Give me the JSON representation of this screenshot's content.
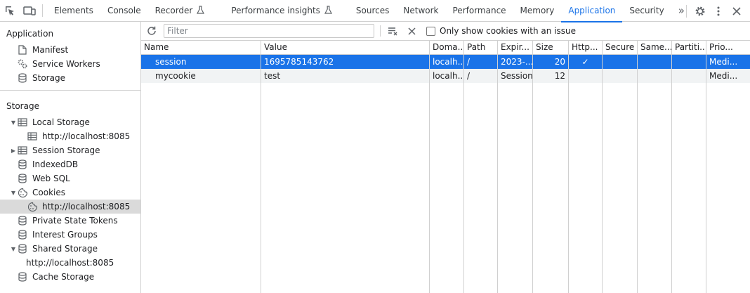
{
  "topbar": {
    "tabs": [
      {
        "label": "Elements"
      },
      {
        "label": "Console"
      },
      {
        "label": "Recorder"
      },
      {
        "label": "Performance insights"
      },
      {
        "label": "Sources"
      },
      {
        "label": "Network"
      },
      {
        "label": "Performance"
      },
      {
        "label": "Memory"
      },
      {
        "label": "Application",
        "active": true
      },
      {
        "label": "Security"
      }
    ],
    "more_label": "»"
  },
  "sidebar": {
    "application_title": "Application",
    "application_items": [
      {
        "label": "Manifest",
        "icon": "document-icon"
      },
      {
        "label": "Service Workers",
        "icon": "gears-icon"
      },
      {
        "label": "Storage",
        "icon": "database-icon"
      }
    ],
    "storage_title": "Storage",
    "storage_items": [
      {
        "label": "Local Storage",
        "icon": "table-icon",
        "expanded": true
      },
      {
        "label": "http://localhost:8085",
        "icon": "table-icon",
        "child": true
      },
      {
        "label": "Session Storage",
        "icon": "table-icon",
        "expanded": false
      },
      {
        "label": "IndexedDB",
        "icon": "database-icon"
      },
      {
        "label": "Web SQL",
        "icon": "database-icon"
      },
      {
        "label": "Cookies",
        "icon": "cookie-icon",
        "expanded": true
      },
      {
        "label": "http://localhost:8085",
        "icon": "cookie-icon",
        "child": true,
        "selected": true
      },
      {
        "label": "Private State Tokens",
        "icon": "database-icon"
      },
      {
        "label": "Interest Groups",
        "icon": "database-icon"
      },
      {
        "label": "Shared Storage",
        "icon": "database-icon",
        "expanded": true
      },
      {
        "label": "http://localhost:8085",
        "icon": "",
        "child": true
      },
      {
        "label": "Cache Storage",
        "icon": "database-icon"
      }
    ]
  },
  "toolbar": {
    "filter_placeholder": "Filter",
    "filter_value": "",
    "only_issues_label": "Only show cookies with an issue",
    "only_issues_checked": false
  },
  "table": {
    "columns": [
      "Name",
      "Value",
      "Doma...",
      "Path",
      "Expir...",
      "Size",
      "Http...",
      "Secure",
      "Same...",
      "Partiti...",
      "Prio..."
    ],
    "rows": [
      {
        "name": "session",
        "value": "1695785143762",
        "domain": "localh...",
        "path": "/",
        "expires": "2023-...",
        "size": "20",
        "httponly": "✓",
        "secure": "",
        "samesite": "",
        "partition": "",
        "priority": "Medi...",
        "selected": true
      },
      {
        "name": "mycookie",
        "value": "test",
        "domain": "localh...",
        "path": "/",
        "expires": "Session",
        "size": "12",
        "httponly": "",
        "secure": "",
        "samesite": "",
        "partition": "",
        "priority": "Medi...",
        "selected": false
      }
    ]
  },
  "colors": {
    "accent": "#1a73e8",
    "selected_row": "#1a73e8",
    "selected_sidebar": "#dadada"
  }
}
